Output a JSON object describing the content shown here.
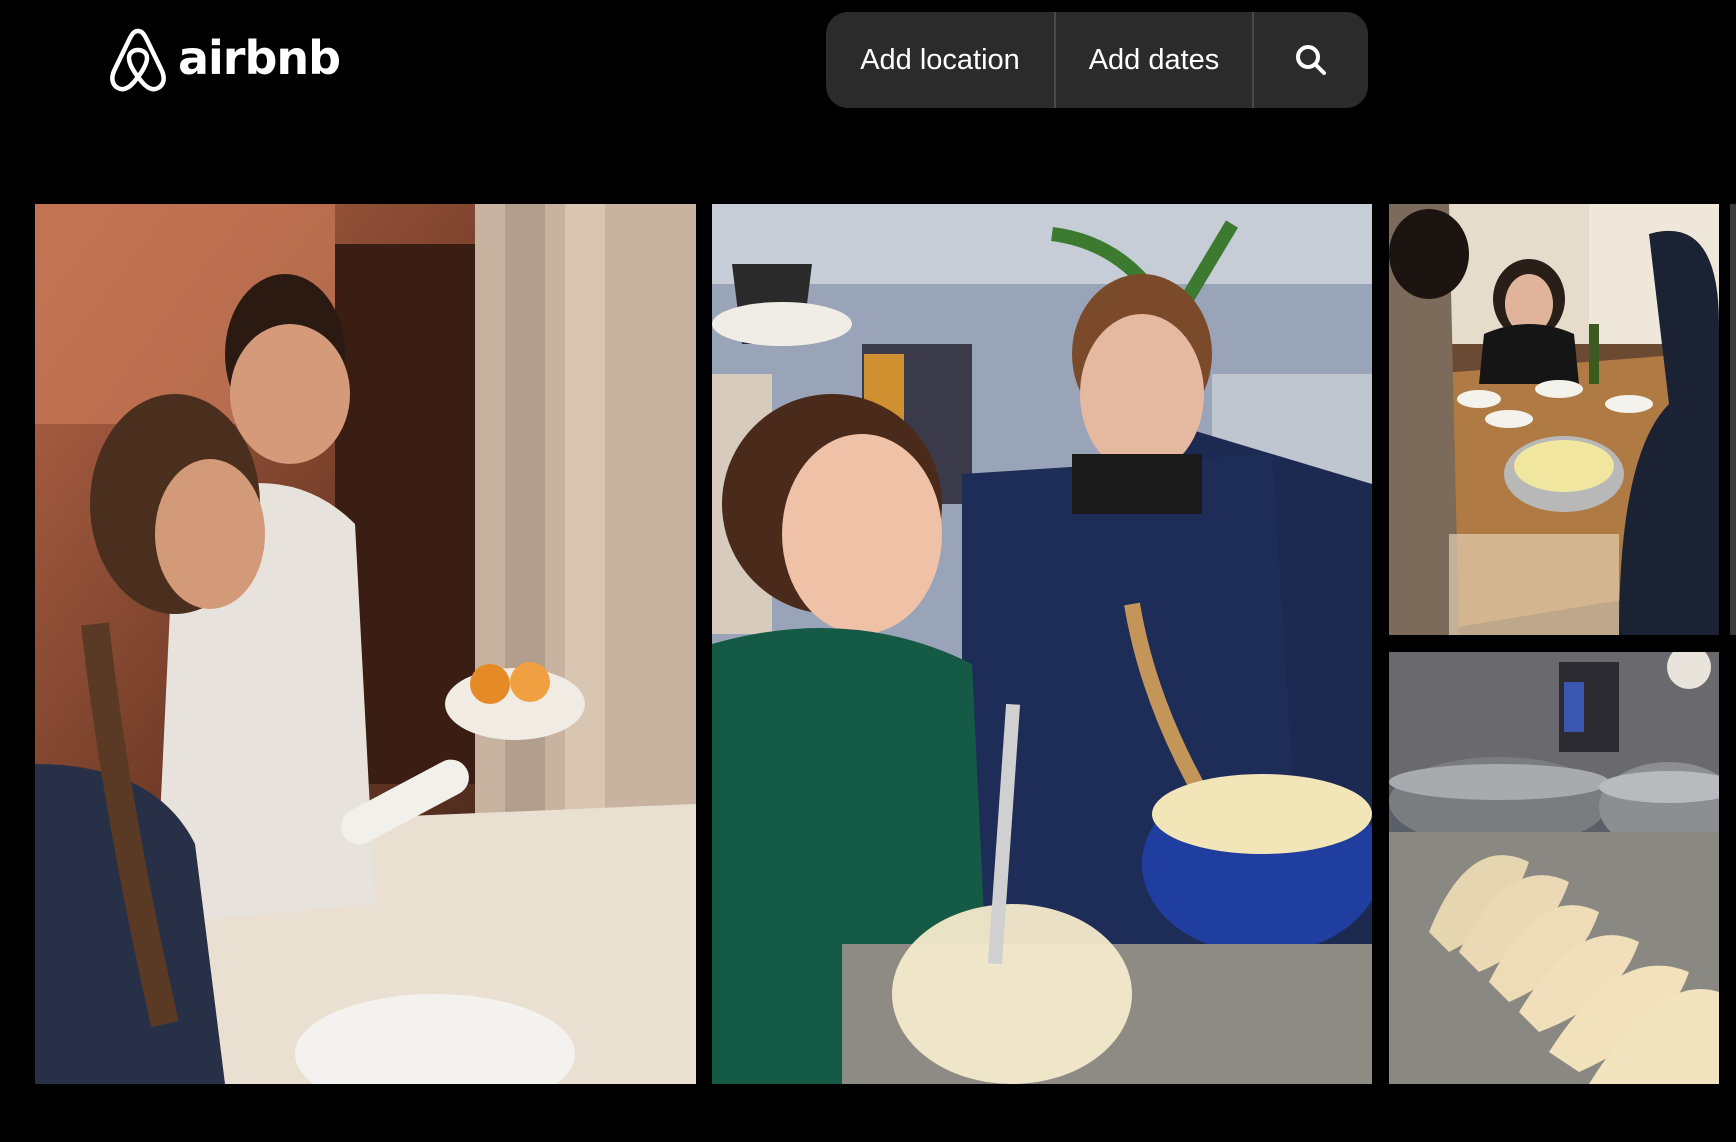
{
  "brand": {
    "name": "airbnb",
    "color": "#ffffff"
  },
  "search": {
    "location_label": "Add location",
    "dates_label": "Add dates",
    "search_icon": "search-icon"
  },
  "gallery": {
    "photos": [
      {
        "name": "photo-couple-rolling-dough",
        "icon": "photo"
      },
      {
        "name": "photo-couple-mashing-potatoes",
        "icon": "photo"
      },
      {
        "name": "photo-dinner-table",
        "icon": "photo"
      },
      {
        "name": "photo-dumplings-closeup",
        "icon": "photo"
      }
    ]
  },
  "colors": {
    "background": "#000000",
    "searchbar": "#2b2b2b",
    "divider": "#4a4a4a"
  }
}
